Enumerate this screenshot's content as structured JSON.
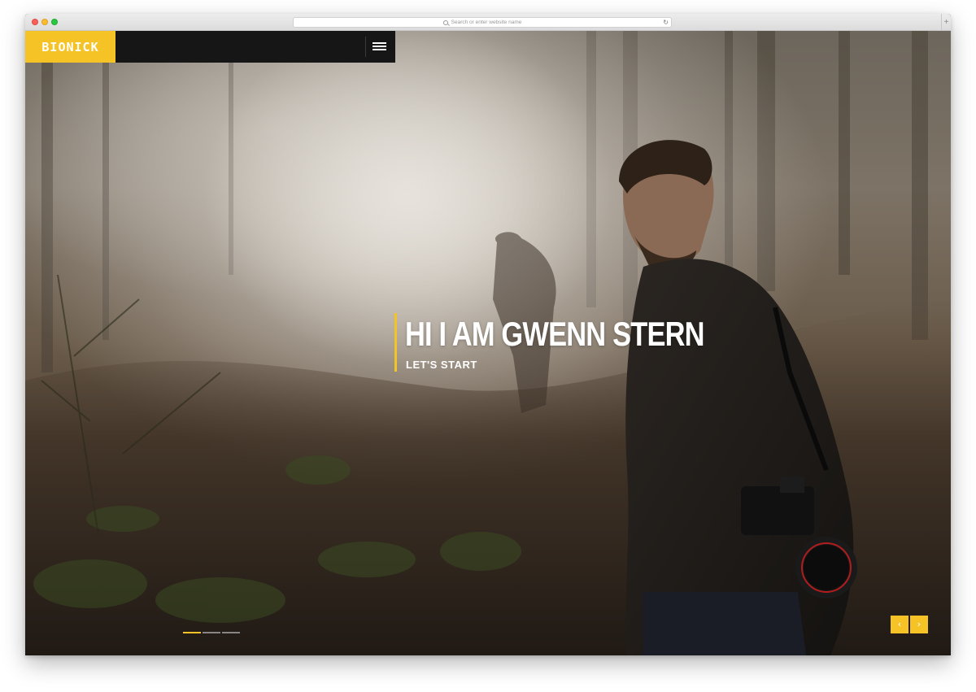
{
  "browser": {
    "address_placeholder": "Search or enter website name",
    "reload_icon": "reload-icon",
    "newtab_label": "+"
  },
  "header": {
    "logo": "BIONICK",
    "menu_icon": "hamburger-icon"
  },
  "hero": {
    "title": "HI I AM GWENN STERN",
    "cta_label": "LET'S START",
    "slides": [
      {
        "active": true
      },
      {
        "active": false
      },
      {
        "active": false
      }
    ],
    "prev_label": "‹",
    "next_label": "›"
  },
  "colors": {
    "accent": "#f5c326",
    "header_bg": "#161616"
  }
}
